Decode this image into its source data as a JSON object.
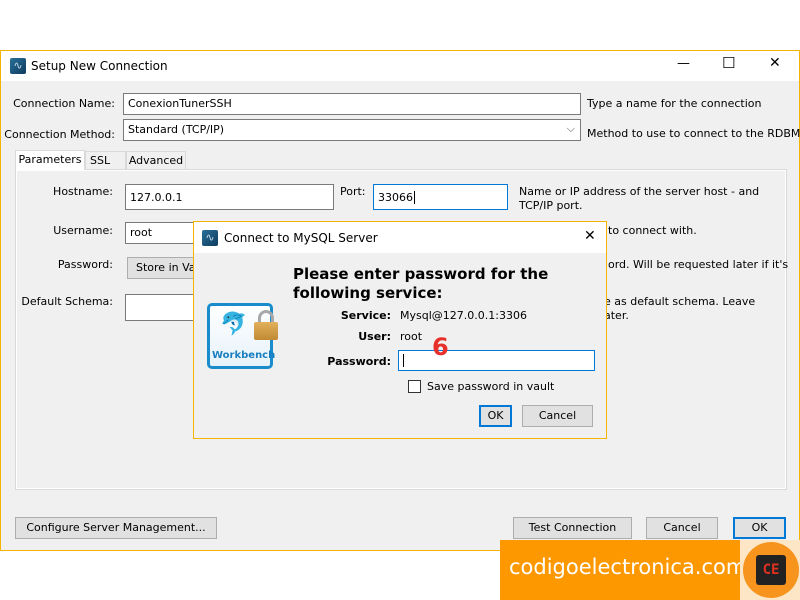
{
  "window": {
    "title": "Setup New Connection",
    "controls": {
      "minimize": "—",
      "maximize": "☐",
      "close": "✕"
    }
  },
  "form": {
    "connection_name": {
      "label": "Connection Name:",
      "value": "ConexionTunerSSH",
      "hint": "Type a name for the connection"
    },
    "connection_method": {
      "label": "Connection Method:",
      "value": "Standard (TCP/IP)",
      "hint": "Method to use to connect to the RDBMS"
    }
  },
  "tabs": [
    {
      "label": "Parameters",
      "active": true
    },
    {
      "label": "SSL"
    },
    {
      "label": "Advanced"
    }
  ],
  "parameters": {
    "hostname": {
      "label": "Hostname:",
      "value": "127.0.0.1"
    },
    "port": {
      "label": "Port:",
      "value": "33066"
    },
    "host_hint_1": "Name or IP address of the server host - and",
    "host_hint_2": "TCP/IP port.",
    "username": {
      "label": "Username:",
      "value": "root",
      "hint_fragment": "to connect with."
    },
    "password": {
      "label": "Password:",
      "button": "Store in Vau",
      "hint_fragment": "ord. Will be requested later if it's"
    },
    "default_schema": {
      "label": "Default Schema:",
      "value": "",
      "hint_fragment_1": "e as default schema. Leave",
      "hint_fragment_2": "ater."
    }
  },
  "footer": {
    "configure": "Configure Server Management...",
    "test": "Test Connection",
    "cancel": "Cancel",
    "ok": "OK"
  },
  "dialog": {
    "title": "Connect to MySQL Server",
    "heading_1": "Please enter password for the",
    "heading_2": "following service:",
    "service_label": "Service:",
    "service_value": "Mysql@127.0.0.1:3306",
    "user_label": "User:",
    "user_value": "root",
    "password_label": "Password:",
    "password_value": "",
    "save_checkbox": "Save password in vault",
    "save_checked": false,
    "ok": "OK",
    "cancel": "Cancel",
    "logo_text": "MySQL Workbench"
  },
  "annotation": "6",
  "watermark": {
    "text": "codigoelectronica.com",
    "logo_text": "CE"
  },
  "colors": {
    "accent_border": "#f5b400",
    "focus": "#0078d7",
    "banner": "#fd9800",
    "annotation": "#e8302a"
  }
}
